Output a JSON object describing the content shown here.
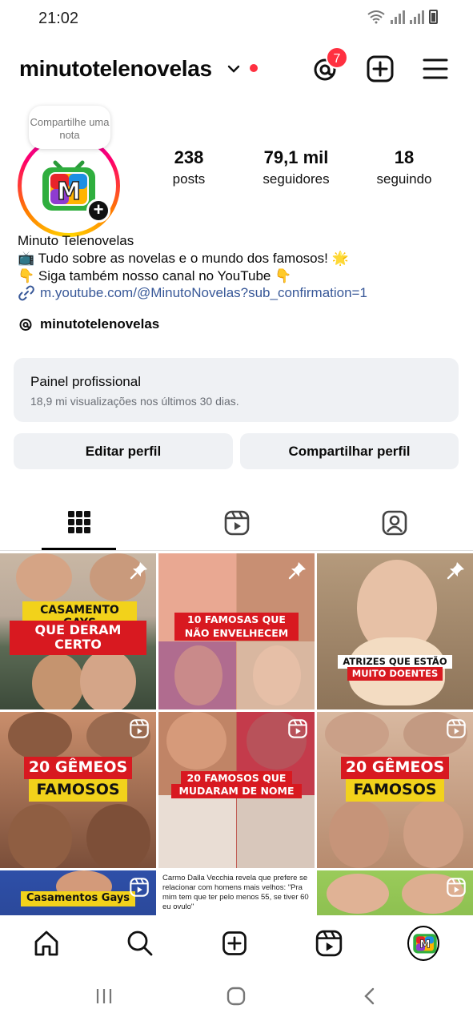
{
  "status_bar": {
    "time": "21:02"
  },
  "header": {
    "username": "minutotelenovelas",
    "threads_badge": "7"
  },
  "profile": {
    "note_prompt": "Compartilhe uma nota",
    "stats": [
      {
        "value": "238",
        "label": "posts"
      },
      {
        "value": "79,1 mil",
        "label": "seguidores"
      },
      {
        "value": "18",
        "label": "seguindo"
      }
    ],
    "name": "Minuto Telenovelas",
    "bio_line1": "📺 Tudo sobre as novelas e o mundo dos famosos! 🌟",
    "bio_line2": "👇 Siga também nosso canal no YouTube 👇",
    "link": "m.youtube.com/@MinutoNovelas?sub_confirmation=1",
    "threads_handle": "minutotelenovelas"
  },
  "dashboard": {
    "title": "Painel profissional",
    "subtitle": "18,9 mi visualizações nos últimos 30 dias."
  },
  "buttons": {
    "edit": "Editar perfil",
    "share": "Compartilhar perfil"
  },
  "grid": [
    {
      "line1": "CASAMENTO GAYS",
      "line2": "QUE DERAM CERTO",
      "icon": "pin-icon"
    },
    {
      "line1": "10 FAMOSAS QUE",
      "line2": "NÃO ENVELHECEM",
      "icon": "pin-icon"
    },
    {
      "line1": "ATRIZES QUE ESTÃO",
      "line2": "MUITO DOENTES",
      "icon": "pin-icon"
    },
    {
      "line1": "20 GÊMEOS",
      "line2": "FAMOSOS",
      "icon": "reel-icon"
    },
    {
      "line1": "20 FAMOSOS QUE",
      "line2": "MUDARAM DE NOME",
      "icon": "reel-icon"
    },
    {
      "line1": "20 GÊMEOS",
      "line2": "FAMOSOS",
      "icon": "reel-icon"
    },
    {
      "line1": "Casamentos Gays",
      "icon": "reel-icon"
    },
    {
      "caption": "Carmo Dalla Vecchia revela que prefere se relacionar com homens mais velhos: \"Pra mim tem que ter pelo menos 55, se tiver 60 eu ovulo\""
    },
    {
      "icon": "reel-icon"
    }
  ],
  "avatar_logo_letter": "M",
  "colors": {
    "accent_red": "#ff3040",
    "link_blue": "#385898",
    "panel_grey": "#eff1f4",
    "banner_red": "#d81920",
    "banner_yellow": "#f2d21b"
  }
}
